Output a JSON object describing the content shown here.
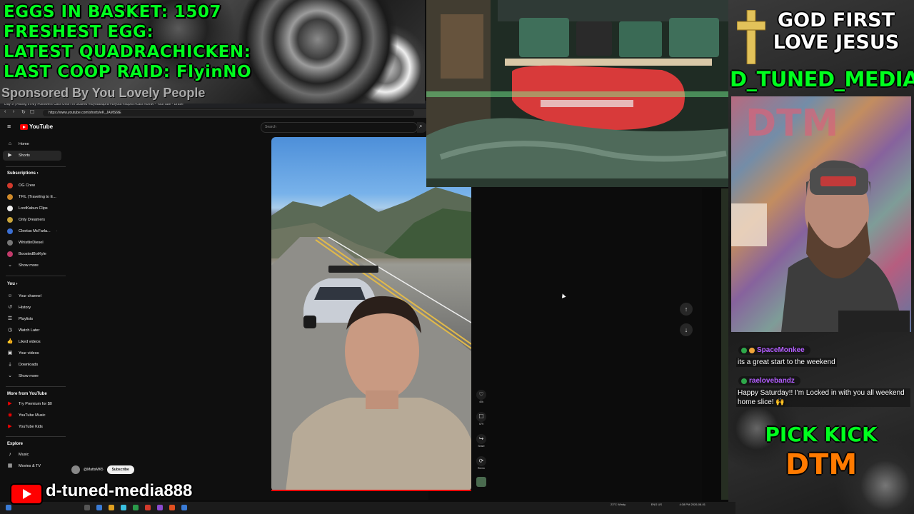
{
  "overlay": {
    "lines": [
      "EGGS IN BASKET: 1507",
      "FRESHEST EGG:",
      "LATEST QUADRACHICKEN:",
      "LAST COOP RAID: FlyinNO"
    ],
    "sponsor": "Sponsored By You Lovely People"
  },
  "browser": {
    "tab_title": "Day 9 | Riding In My Followers Cars Until I'm Scared #toyotasupra #toyota #supra #cars #bmw - YouTube - Brave",
    "url": "https://www.youtube.com/shorts/eK_JAMS6tE"
  },
  "youtube": {
    "logo_text": "YouTube",
    "search_placeholder": "Search",
    "nav": [
      {
        "label": "Home",
        "icon": "home-icon"
      },
      {
        "label": "Shorts",
        "icon": "shorts-icon"
      }
    ],
    "subscriptions_title": "Subscriptions",
    "subscriptions": [
      {
        "label": "OG Crew",
        "color": "#d33a2c"
      },
      {
        "label": "TFIL (Traveling to E...",
        "color": "#d08a2a"
      },
      {
        "label": "LordKabun Clips",
        "color": "#eeeeee"
      },
      {
        "label": "Only Dreamers",
        "color": "#c9a43a"
      },
      {
        "label": "Cleetus McFarla...",
        "color": "#3b6fd3"
      },
      {
        "label": "WhistlinDiesel",
        "color": "#777777"
      },
      {
        "label": "BoostedBoiKyle",
        "color": "#c23a6a"
      },
      {
        "label": "Show more",
        "color": ""
      }
    ],
    "you_title": "You",
    "you_items": [
      {
        "label": "Your channel",
        "icon": "channel-icon"
      },
      {
        "label": "History",
        "icon": "history-icon"
      },
      {
        "label": "Playlists",
        "icon": "playlists-icon"
      },
      {
        "label": "Watch Later",
        "icon": "clock-icon"
      },
      {
        "label": "Liked videos",
        "icon": "thumb-up-icon"
      },
      {
        "label": "Your videos",
        "icon": "video-icon"
      },
      {
        "label": "Downloads",
        "icon": "download-icon"
      },
      {
        "label": "Show more",
        "icon": "chevron-down-icon"
      }
    ],
    "more_title": "More from YouTube",
    "more_items": [
      {
        "label": "Try Premium for $0",
        "color": "#ff0000"
      },
      {
        "label": "YouTube Music",
        "color": "#ff0000"
      },
      {
        "label": "YouTube Kids",
        "color": "#ff0000"
      }
    ],
    "explore_title": "Explore",
    "explore_items": [
      {
        "label": "Music",
        "icon": "music-icon"
      },
      {
        "label": "Movies & TV",
        "icon": "movies-icon"
      }
    ],
    "short": {
      "channel_handle": "@MattsMK5",
      "subscribe_label": "Subscribe",
      "actions": [
        {
          "icon": "like-icon",
          "label": "40k"
        },
        {
          "icon": "comment-icon",
          "label": "679"
        },
        {
          "icon": "share-icon",
          "label": "Share"
        },
        {
          "icon": "remix-icon",
          "label": "Remix"
        }
      ],
      "progress": 1.0
    }
  },
  "right_panel": {
    "line1": "GOD FIRST",
    "line2": "LOVE JESUS",
    "brand_name": "D_TUNED_MEDIA",
    "pick": "PICK KICK",
    "dtm": "DTM"
  },
  "chat": [
    {
      "user": "SpaceMonkee",
      "message": "its a great start to the weekend"
    },
    {
      "user": "raelovebandz",
      "message": "Happy Saturday!! I'm Locked in with you all weekend home slice! 🙌"
    }
  ],
  "brand_handle": "d-tuned-media888",
  "tray": {
    "weather": "23°C Windy",
    "lang": "ENG US",
    "time": "4:38 PM",
    "date": "2026-08-01"
  },
  "colors": {
    "overlay_green": "#00ff1e",
    "yt_red": "#ff0000",
    "chat_name": "#b25cff",
    "dtm_orange": "#ff7a00"
  }
}
